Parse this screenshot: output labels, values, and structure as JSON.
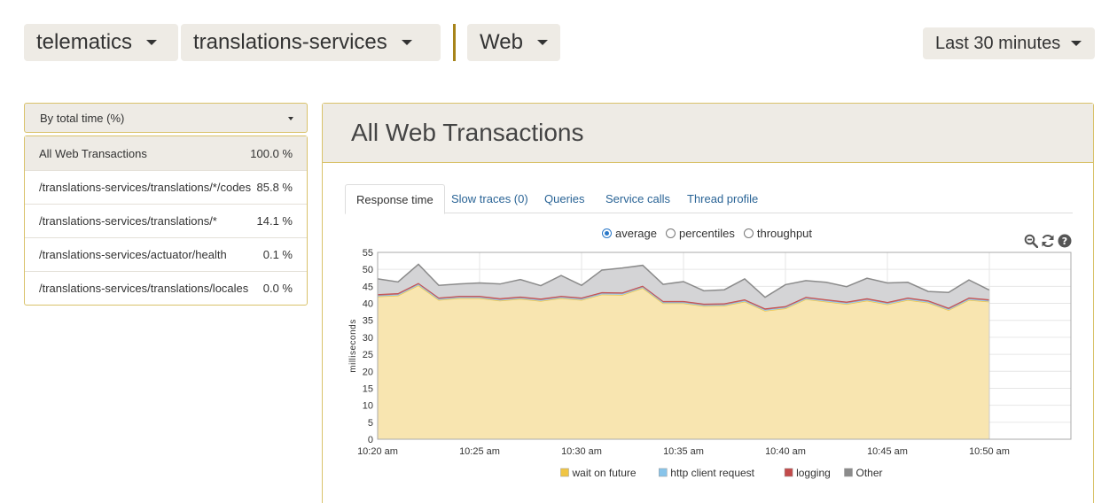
{
  "header": {
    "app": "telematics",
    "agent": "translations-services",
    "transaction_type": "Web",
    "time_range": "Last 30 minutes"
  },
  "sidebar": {
    "sort_label": "By total time (%)",
    "transactions": [
      {
        "name": "All Web Transactions",
        "value": "100.0 %"
      },
      {
        "name": "/translations-services/translations/*/codes",
        "value": "85.8 %"
      },
      {
        "name": "/translations-services/translations/*",
        "value": "14.1 %"
      },
      {
        "name": "/translations-services/actuator/health",
        "value": "0.1 %"
      },
      {
        "name": "/translations-services/translations/locales",
        "value": "0.0 %"
      }
    ]
  },
  "main": {
    "title": "All Web Transactions",
    "tabs": [
      {
        "label": "Response time"
      },
      {
        "label": "Slow traces (0)"
      },
      {
        "label": "Queries"
      },
      {
        "label": "Service calls"
      },
      {
        "label": "Thread profile"
      }
    ],
    "view_options": [
      {
        "label": "average",
        "selected": true
      },
      {
        "label": "percentiles",
        "selected": false
      },
      {
        "label": "throughput",
        "selected": false
      }
    ],
    "tool_icons": [
      "zoom-out-icon",
      "refresh-icon",
      "help-icon"
    ]
  },
  "chart_data": {
    "type": "area",
    "ylabel": "milliseconds",
    "ylim": [
      0,
      55
    ],
    "yticks": [
      0,
      5,
      10,
      15,
      20,
      25,
      30,
      35,
      40,
      45,
      50,
      55
    ],
    "xtick_labels": [
      "10:20 am",
      "10:25 am",
      "10:30 am",
      "10:35 am",
      "10:40 am",
      "10:45 am",
      "10:50 am"
    ],
    "x_minutes": [
      0,
      1,
      2,
      3,
      4,
      5,
      6,
      7,
      8,
      9,
      10,
      11,
      12,
      13,
      14,
      15,
      16,
      17,
      18,
      19,
      20,
      21,
      22,
      23,
      24,
      25,
      26,
      27,
      28,
      29,
      30
    ],
    "xlim_minutes": [
      0,
      34
    ],
    "grid": true,
    "legend_position": "bottom",
    "series": [
      {
        "name": "wait on future",
        "color": "#f0c544",
        "fill": "#f8e5b0",
        "values": [
          42,
          42.3,
          45.3,
          41,
          41.5,
          41.5,
          40.8,
          41.3,
          40.7,
          41.5,
          41,
          42.6,
          42.5,
          44.5,
          40,
          40,
          39.2,
          39.3,
          40.5,
          37.8,
          38.5,
          41.2,
          40.5,
          39.8,
          40.8,
          39.7,
          41,
          40.2,
          38,
          41,
          40.5
        ]
      },
      {
        "name": "http client request",
        "color": "#88c4ea",
        "fill": "#bcd9ec",
        "values": [
          0.3,
          0.3,
          0.3,
          0.3,
          0.3,
          0.3,
          0.3,
          0.3,
          0.3,
          0.3,
          0.3,
          0.3,
          0.3,
          0.3,
          0.3,
          0.3,
          0.3,
          0.3,
          0.3,
          0.3,
          0.3,
          0.3,
          0.3,
          0.3,
          0.3,
          0.3,
          0.3,
          0.3,
          0.3,
          0.3,
          0.3
        ]
      },
      {
        "name": "logging",
        "color": "#c34a4a",
        "fill": "#c96a6a",
        "values": [
          0.4,
          0.4,
          0.4,
          0.4,
          0.4,
          0.4,
          0.4,
          0.4,
          0.4,
          0.4,
          0.4,
          0.4,
          0.4,
          0.4,
          0.4,
          0.4,
          0.4,
          0.4,
          0.4,
          0.4,
          0.4,
          0.4,
          0.4,
          0.4,
          0.4,
          0.4,
          0.4,
          0.4,
          0.4,
          0.4,
          0.4
        ]
      },
      {
        "name": "Other",
        "color": "#8b8b8b",
        "fill": "#d4d4d6",
        "values": [
          4.5,
          3.3,
          5.5,
          3.6,
          3.5,
          3.8,
          4.2,
          5,
          3.8,
          6,
          3.6,
          6.5,
          7.2,
          6,
          4.9,
          5.7,
          3.8,
          4,
          6,
          3.3,
          6.3,
          4.8,
          5,
          4.4,
          5.9,
          5.6,
          4.5,
          2.6,
          4.5,
          5.2,
          2.7
        ]
      }
    ]
  }
}
